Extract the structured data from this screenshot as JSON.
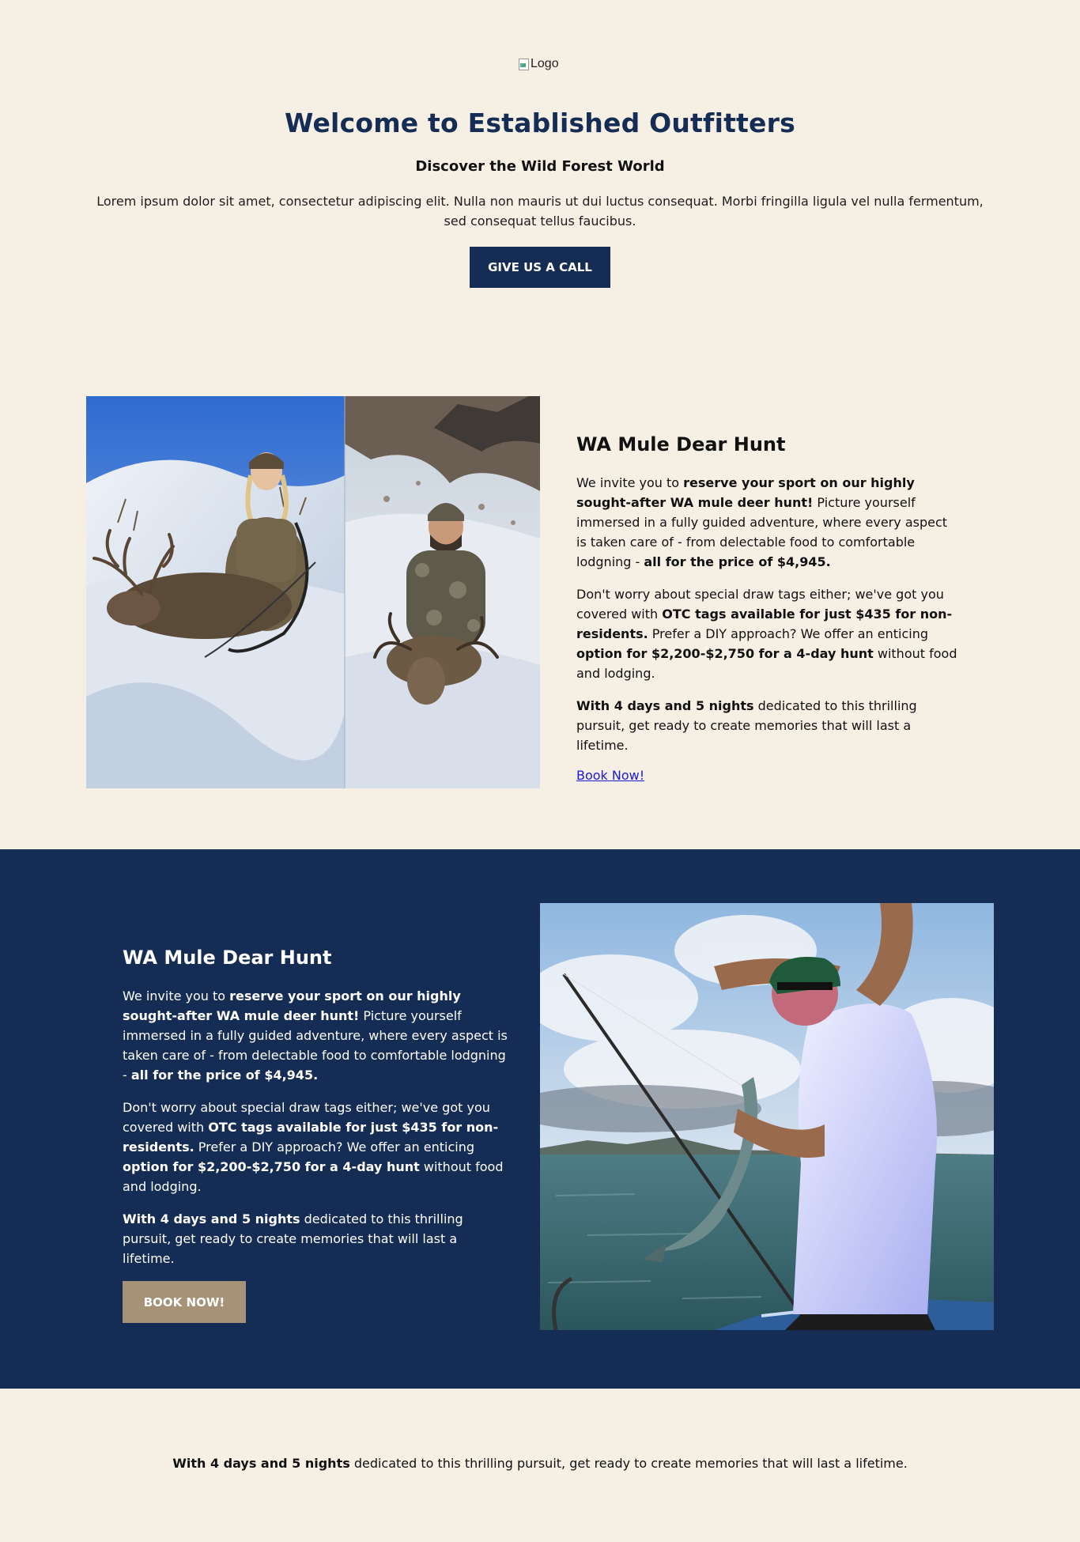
{
  "hero": {
    "logo_alt": "Logo",
    "title": "Welcome to Established Outfitters",
    "subtitle": "Discover the Wild Forest World",
    "description": "Lorem ipsum dolor sit amet, consectetur adipiscing elit. Nulla non mauris ut dui luctus consequat. Morbi fringilla ligula vel nulla fermentum, sed consequat tellus faucibus.",
    "cta_label": "GIVE US A CALL"
  },
  "section1": {
    "title": "WA Mule Dear Hunt",
    "p1": {
      "t1": "We invite you to ",
      "b1": "reserve your sport on our highly sought-after WA mule deer hunt!",
      "t2": " Picture yourself immersed in a fully guided adventure, where every aspect is taken care of - from delectable food to comfortable lodgning - ",
      "b2": "all for the price of $4,945."
    },
    "p2": {
      "t1": "Don't worry about special draw tags either; we've got you covered with ",
      "b1": "OTC tags available for just $435 for non-residents.",
      "t2": " Prefer a DIY approach? We offer an enticing ",
      "b2": "option for $2,200-$2,750 for a 4-day hunt",
      "t3": " without food and lodging."
    },
    "p3": {
      "b1": "With 4 days and 5 nights",
      "t1": " dedicated to this thrilling pursuit, get ready to create memories that will last a lifetime."
    },
    "link_label": "Book Now!"
  },
  "section2": {
    "title": "WA Mule Dear Hunt",
    "p1": {
      "t1": "We invite you to ",
      "b1": "reserve your sport on our highly sought-after WA mule deer hunt!",
      "t2": " Picture yourself immersed in a fully guided adventure, where every aspect is taken care of - from delectable food to comfortable lodgning - ",
      "b2": "all for the price of $4,945."
    },
    "p2": {
      "t1": "Don't worry about special draw tags either; we've got you covered with ",
      "b1": "OTC tags available for just $435 for non-residents.",
      "t2": " Prefer a DIY approach? We offer an enticing ",
      "b2": "option for $2,200-$2,750 for a 4-day hunt",
      "t3": " without food and lodging."
    },
    "p3": {
      "b1": "With 4 days and 5 nights",
      "t1": " dedicated to this thrilling pursuit, get ready to create memories that will last a lifetime."
    },
    "button_label": "BOOK NOW!"
  },
  "footer": {
    "b1": "With 4 days and 5 nights",
    "t1": " dedicated to this thrilling pursuit, get ready to create memories that will last a lifetime."
  },
  "colors": {
    "background": "#f5efe4",
    "navy": "#152c54",
    "tan_button": "#a69377",
    "link": "#1a1ad4"
  }
}
